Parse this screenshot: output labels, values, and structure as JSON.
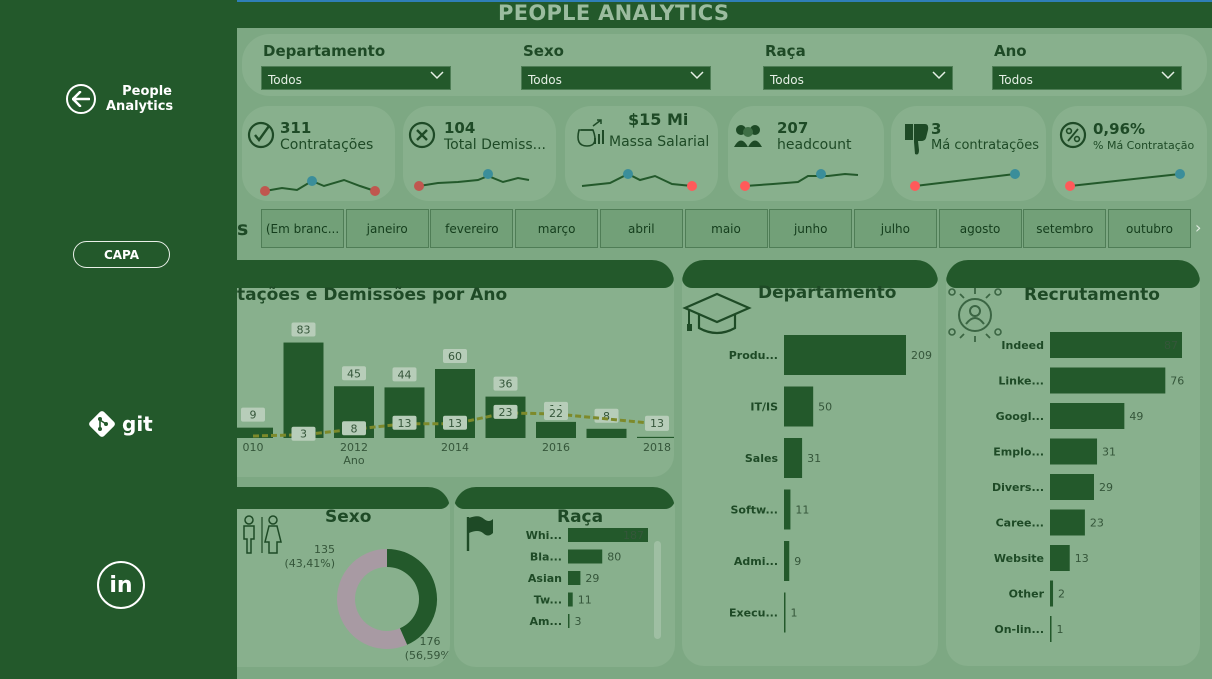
{
  "sidebar": {
    "home_label_line1": "People",
    "home_label_line2": "Analytics",
    "capa_label": "CAPA",
    "git_label": "git",
    "linkedin_label": "in"
  },
  "header": {
    "title": "PEOPLE ANALYTICS"
  },
  "filters": [
    {
      "label": "Departamento",
      "value": "Todos"
    },
    {
      "label": "Sexo",
      "value": "Todos"
    },
    {
      "label": "Raça",
      "value": "Todos"
    },
    {
      "label": "Ano",
      "value": "Todos"
    }
  ],
  "kpis": [
    {
      "value": "311",
      "label": "Contratações",
      "icon": "check-circle-icon"
    },
    {
      "value": "104",
      "label": "Total Demiss...",
      "icon": "x-circle-icon"
    },
    {
      "value": "$15 Mi",
      "label": "Massa Salarial",
      "icon": "money-bag-icon"
    },
    {
      "value": "207",
      "label": "headcount",
      "icon": "people-icon"
    },
    {
      "value": "3",
      "label": "Má contratações",
      "icon": "thumbs-down-icon"
    },
    {
      "value": "0,96%",
      "label": "% Má Contratação",
      "icon": "percent-icon"
    }
  ],
  "months": {
    "lead_text": "s",
    "items": [
      "(Em branc...",
      "janeiro",
      "fevereiro",
      "março",
      "abril",
      "maio",
      "junho",
      "julho",
      "agosto",
      "setembro",
      "outubro"
    ]
  },
  "chart_data": [
    {
      "type": "bar",
      "title": "tações e Demissões por Ano",
      "xlabel": "Ano",
      "x_tick_labels": [
        "010",
        "2012",
        "2014",
        "2016",
        "2018"
      ],
      "categories": [
        "2010",
        "2011",
        "2012",
        "2013",
        "2014",
        "2015",
        "2016",
        "2017",
        "2018"
      ],
      "series": [
        {
          "values": [
            9,
            83,
            45,
            44,
            60,
            36,
            14,
            8,
            1
          ]
        },
        {
          "values": [
            null,
            3,
            8,
            13,
            13,
            23,
            22,
            null,
            13
          ]
        }
      ]
    },
    {
      "type": "bar",
      "title": "Departamento",
      "categories": [
        "Produ...",
        "IT/IS",
        "Sales",
        "Softw...",
        "Admi...",
        "Execu..."
      ],
      "values": [
        209,
        50,
        31,
        11,
        9,
        1
      ]
    },
    {
      "type": "bar",
      "title": "Recrutamento",
      "categories": [
        "Indeed",
        "Linke...",
        "Googl...",
        "Emplo...",
        "Divers...",
        "Caree...",
        "Website",
        "Other",
        "On-lin..."
      ],
      "values": [
        87,
        76,
        49,
        31,
        29,
        23,
        13,
        2,
        1
      ]
    },
    {
      "type": "pie",
      "title": "Sexo",
      "values": [
        135,
        176
      ],
      "labels": [
        "(43,41%)",
        "(56,59%)"
      ],
      "colors": [
        "#23592b",
        "#a89aa3"
      ]
    },
    {
      "type": "bar",
      "title": "Raça",
      "categories": [
        "Whi...",
        "Bla...",
        "Asian",
        "Tw...",
        "Am..."
      ],
      "values": [
        187,
        80,
        29,
        11,
        3
      ]
    }
  ],
  "colors": {
    "sidebar": "#23592b",
    "background": "#7da883",
    "panel": "#88b08d",
    "bar": "#23592b",
    "sparkline_start": "#c0574f",
    "sparkline_end": "#ff5a5a",
    "sparkline_mid": "#3b8e9a"
  }
}
